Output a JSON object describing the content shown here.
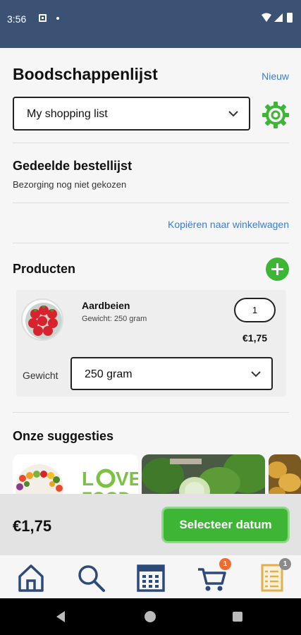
{
  "status_bar": {
    "time": "3:56"
  },
  "header": {
    "title": "Boodschappenlijst",
    "new_label": "Nieuw"
  },
  "list_select": {
    "value": "My shopping list"
  },
  "shared": {
    "title": "Gedeelde bestellijst",
    "subtitle": "Bezorging nog niet gekozen"
  },
  "copy_label": "Kopiëren naar winkelwagen",
  "products": {
    "title": "Producten",
    "items": [
      {
        "name": "Aardbeien",
        "weight_text": "Gewicht: 250 gram",
        "quantity": "1",
        "price": "€1,75",
        "weight_label": "Gewicht",
        "weight_value": "250 gram"
      }
    ]
  },
  "suggestions": {
    "title": "Onze suggesties",
    "cards": [
      "fruit-veg-illustration",
      "love-food-logo",
      "vegetables-photo",
      "potatoes-photo"
    ]
  },
  "bottom_bar": {
    "total": "€1,75",
    "button_label": "Selecteer datum"
  },
  "nav": {
    "items": [
      {
        "icon": "home-icon"
      },
      {
        "icon": "search-icon"
      },
      {
        "icon": "calendar-icon"
      },
      {
        "icon": "cart-icon",
        "badge": "1"
      },
      {
        "icon": "list-icon",
        "badge": "1"
      }
    ]
  },
  "colors": {
    "header_bg": "#3c5275",
    "accent_green": "#3db535",
    "link_blue": "#3a7bd5",
    "nav_icon": "#2d4a78",
    "list_icon": "#e0b050",
    "cart_badge": "#f26a2e",
    "list_badge": "#8a8a8a"
  }
}
